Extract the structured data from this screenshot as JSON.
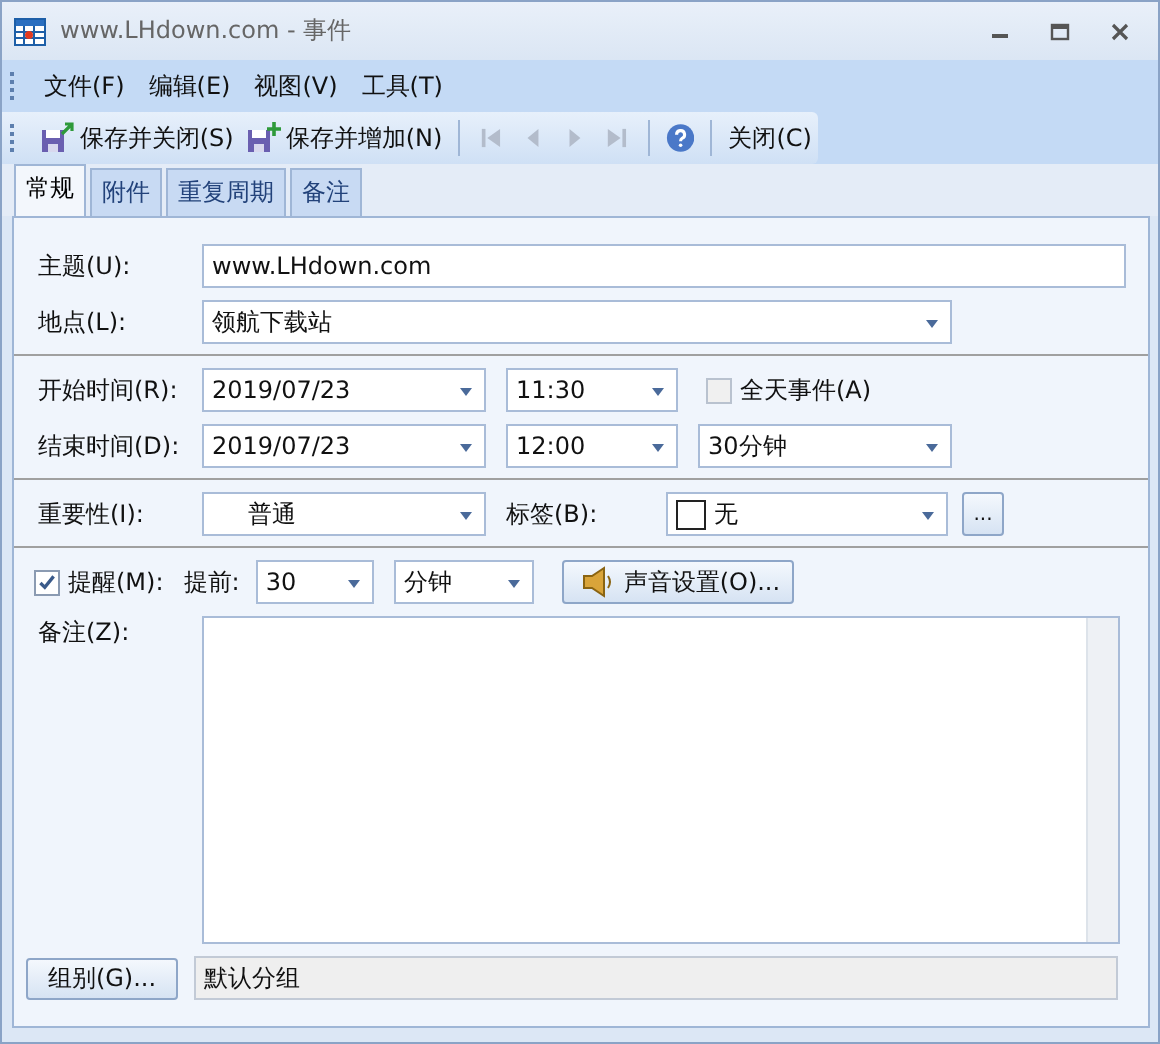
{
  "window": {
    "title": "www.LHdown.com - 事件"
  },
  "menu": [
    "文件(F)",
    "编辑(E)",
    "视图(V)",
    "工具(T)"
  ],
  "toolbar": [
    [
      {
        "kind": "save",
        "label": "保存并关闭(S)",
        "disabled": false
      },
      {
        "kind": "saveadd",
        "label": "保存并增加(N)",
        "disabled": false
      }
    ],
    [
      {
        "kind": "first",
        "disabled": true
      },
      {
        "kind": "prev",
        "disabled": true
      },
      {
        "kind": "next",
        "disabled": true
      },
      {
        "kind": "last",
        "disabled": true
      }
    ],
    [
      {
        "kind": "help",
        "disabled": false
      }
    ],
    [
      {
        "kind": "text",
        "label": "关闭(C)",
        "disabled": false
      }
    ]
  ],
  "tabs": [
    {
      "label": "常规",
      "selected": true
    },
    {
      "label": "附件",
      "selected": false
    },
    {
      "label": "重复周期",
      "selected": false
    },
    {
      "label": "备注",
      "selected": false
    }
  ],
  "subject": {
    "label": "主题(U):",
    "value": "www.LHdown.com"
  },
  "location": {
    "label": "地点(L):",
    "value": "领航下载站"
  },
  "start": {
    "label": "开始时间(R):",
    "date": "2019/07/23",
    "time": "11:30"
  },
  "all_day": {
    "label": "全天事件(A)",
    "checked": false
  },
  "end": {
    "label": "结束时间(D):",
    "date": "2019/07/23",
    "time": "12:00",
    "duration": "30分钟"
  },
  "importance": {
    "label": "重要性(I):",
    "value": "普通"
  },
  "tag": {
    "label": "标签(B):",
    "value": "无",
    "more": "..."
  },
  "reminder": {
    "label": "提醒(M):",
    "checked": true,
    "before_label": "提前:",
    "amount": "30",
    "unit": "分钟",
    "sound_button": "声音设置(O)..."
  },
  "notes": {
    "label": "备注(Z):"
  },
  "group": {
    "button": "组别(G)...",
    "value": "默认分组"
  }
}
